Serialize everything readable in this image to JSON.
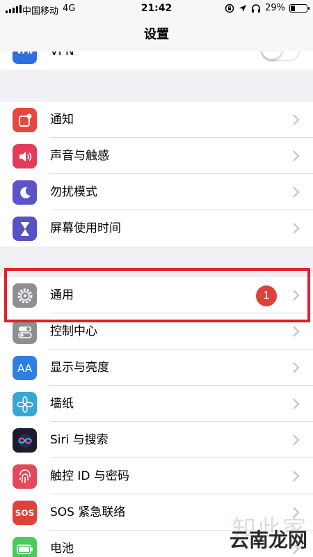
{
  "status_bar": {
    "carrier": "中国移动",
    "network": "4G",
    "time": "21:42",
    "battery": "29%",
    "battery_level": 0.29
  },
  "nav": {
    "title": "设置"
  },
  "vpn": {
    "label": "VPN",
    "icon": "vpn-icon",
    "toggle_on": false
  },
  "group1": [
    {
      "label": "通知",
      "icon": "notification-icon",
      "color": "#e4483f"
    },
    {
      "label": "声音与触感",
      "icon": "speaker-icon",
      "color": "#e23b5c"
    },
    {
      "label": "勿扰模式",
      "icon": "moon-icon",
      "color": "#5b55c9"
    },
    {
      "label": "屏幕使用时间",
      "icon": "hourglass-icon",
      "color": "#5850c3"
    }
  ],
  "group2": [
    {
      "label": "通用",
      "icon": "gear-icon",
      "color": "#8e8e93",
      "badge": "1"
    },
    {
      "label": "控制中心",
      "icon": "switches-icon",
      "color": "#8e8e93"
    },
    {
      "label": "显示与亮度",
      "icon": "aa-icon",
      "color": "#2f7fe0",
      "glyph": "AA"
    },
    {
      "label": "墙纸",
      "icon": "flower-icon",
      "color": "#36a6d6"
    },
    {
      "label": "Siri 与搜索",
      "icon": "siri-icon",
      "color": "#1c1c2e"
    },
    {
      "label": "触控 ID 与密码",
      "icon": "fingerprint-icon",
      "color": "#e24a5a"
    },
    {
      "label": "SOS 紧急联络",
      "icon": "sos-icon",
      "color": "#e0413a",
      "glyph": "SOS"
    },
    {
      "label": "电池",
      "icon": "battery-icon",
      "color": "#4bc95c"
    }
  ],
  "watermark": {
    "top": "知此家",
    "bottom": "云南龙网"
  }
}
